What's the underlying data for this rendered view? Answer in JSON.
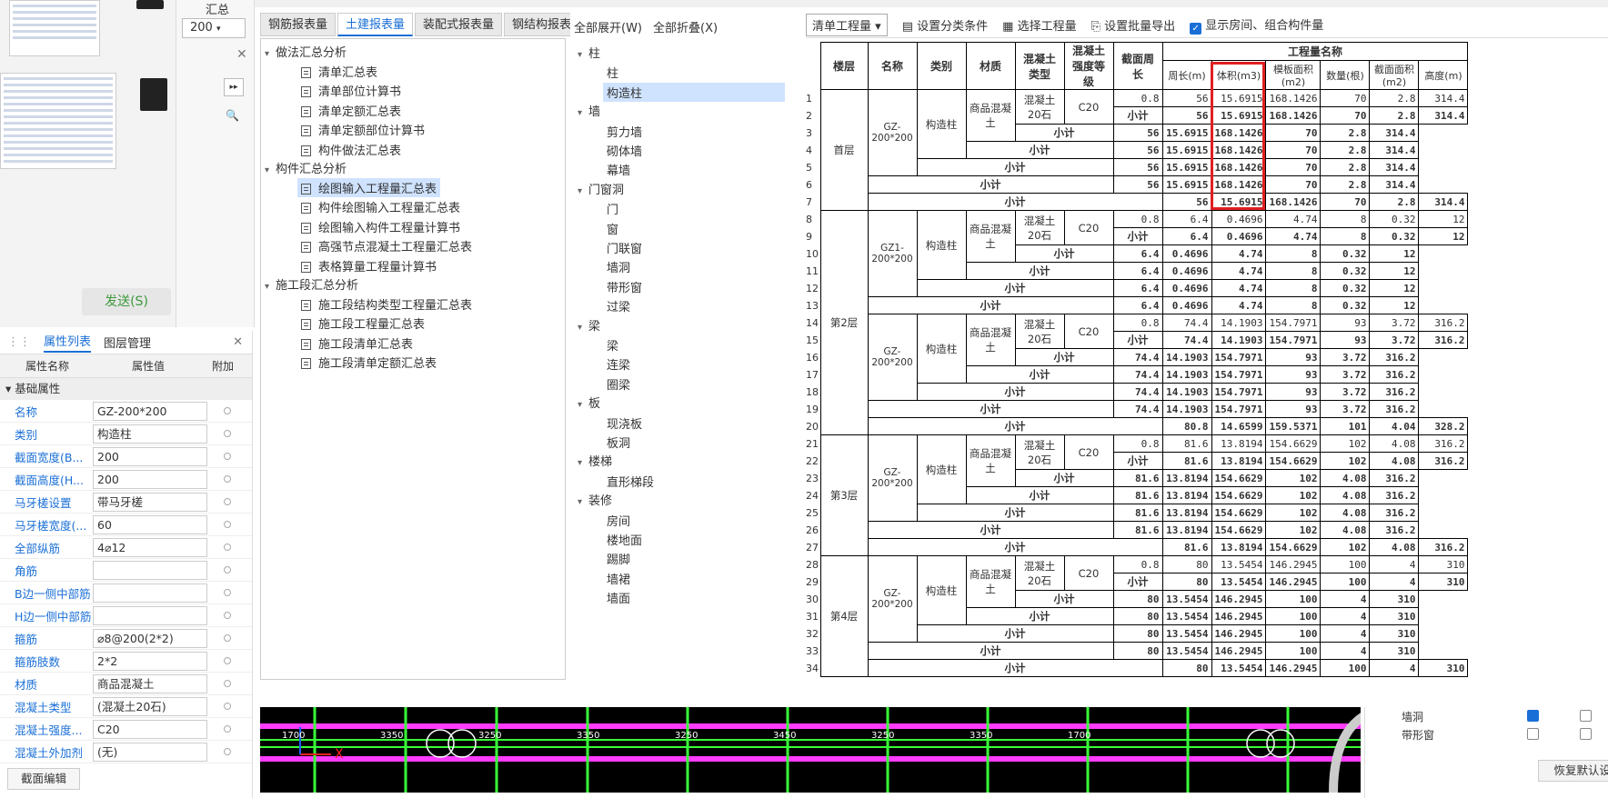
{
  "header": {
    "summary": "汇总",
    "spec": "200"
  },
  "chat": {
    "send_label": "发送(S)"
  },
  "report_tabs": [
    "钢筋报表量",
    "土建报表量",
    "装配式报表量",
    "钢结构报表量"
  ],
  "tree1": {
    "groups": [
      {
        "label": "做法汇总分析",
        "items": [
          "清单汇总表",
          "清单部位计算书",
          "清单定额汇总表",
          "清单定额部位计算书",
          "构件做法汇总表"
        ]
      },
      {
        "label": "构件汇总分析",
        "items": [
          "绘图输入工程量汇总表",
          "构件绘图输入工程量汇总表",
          "绘图输入构件工程量计算书",
          "高强节点混凝土工程量汇总表",
          "表格算量工程量计算书"
        ]
      },
      {
        "label": "施工段汇总分析",
        "items": [
          "施工段结构类型工程量汇总表",
          "施工段工程量汇总表",
          "施工段清单汇总表",
          "施工段清单定额汇总表"
        ]
      }
    ]
  },
  "tree2": {
    "expand_all": "全部展开(W)",
    "collapse_all": "全部折叠(X)",
    "groups": [
      {
        "label": "柱",
        "items": [
          "柱",
          "构造柱"
        ]
      },
      {
        "label": "墙",
        "items": [
          "剪力墙",
          "砌体墙",
          "幕墙"
        ]
      },
      {
        "label": "门窗洞",
        "items": [
          "门",
          "窗",
          "门联窗",
          "墙洞",
          "带形窗",
          "过梁"
        ]
      },
      {
        "label": "梁",
        "items": [
          "梁",
          "连梁",
          "圈梁"
        ]
      },
      {
        "label": "板",
        "items": [
          "现浇板",
          "板洞"
        ]
      },
      {
        "label": "楼梯",
        "items": [
          "直形梯段"
        ]
      },
      {
        "label": "装修",
        "items": [
          "房间",
          "楼地面",
          "踢脚",
          "墙裙",
          "墙面"
        ]
      }
    ]
  },
  "right_toolbar": {
    "combo": "清单工程量",
    "filter": "设置分类条件",
    "select": "选择工程量",
    "export": "设置批量导出",
    "show_rooms": "显示房间、组合构件量"
  },
  "props": {
    "tab_props": "属性列表",
    "tab_layers": "图层管理",
    "col_name": "属性名称",
    "col_value": "属性值",
    "col_extra": "附加",
    "section": "基础属性",
    "rows": [
      {
        "name": "名称",
        "value": "GZ-200*200"
      },
      {
        "name": "类别",
        "value": "构造柱"
      },
      {
        "name": "截面宽度(B...",
        "value": "200"
      },
      {
        "name": "截面高度(H...",
        "value": "200"
      },
      {
        "name": "马牙槎设置",
        "value": "带马牙槎"
      },
      {
        "name": "马牙槎宽度(...",
        "value": "60"
      },
      {
        "name": "全部纵筋",
        "value": "4⌀12"
      },
      {
        "name": "角筋",
        "value": ""
      },
      {
        "name": "B边一侧中部筋",
        "value": ""
      },
      {
        "name": "H边一侧中部筋",
        "value": ""
      },
      {
        "name": "箍筋",
        "value": "⌀8@200(2*2)"
      },
      {
        "name": "箍筋肢数",
        "value": "2*2"
      },
      {
        "name": "材质",
        "value": "商品混凝土"
      },
      {
        "name": "混凝土类型",
        "value": "(混凝土20石)"
      },
      {
        "name": "混凝土强度...",
        "value": "C20"
      },
      {
        "name": "混凝土外加剂",
        "value": "(无)"
      }
    ],
    "section_edit": "截面编辑"
  },
  "table": {
    "group_title": "工程量名称",
    "headers": [
      "楼层",
      "名称",
      "类别",
      "材质",
      "混凝土类型",
      "混凝土强度等级",
      "截面周长",
      "周长(m)",
      "体积(m3)",
      "模板面积(m2)",
      "数量(根)",
      "截面面积(m2)",
      "高度(m)"
    ],
    "sub_total": "小计",
    "floors": [
      {
        "floor": "首层",
        "name": "GZ-200*200",
        "cat": "构造柱",
        "mat": "商品混凝土",
        "ctype": "混凝土20石",
        "grade": "C20",
        "peri": "0.8",
        "vals": [
          [
            "56",
            "15.6915",
            "168.1426",
            "70",
            "2.8",
            "314.4"
          ],
          [
            "56",
            "15.6915",
            "168.1426",
            "70",
            "2.8",
            "314.4"
          ]
        ],
        "total": [
          "56",
          "15.6915",
          "168.1426",
          "70",
          "2.8",
          "314.4"
        ]
      },
      {
        "floor": "第2层",
        "blocks": [
          {
            "name": "GZ1-200*200",
            "cat": "构造柱",
            "mat": "商品混凝土",
            "ctype": "混凝土20石",
            "grade": "C20",
            "peri": "0.8",
            "vals": [
              "6.4",
              "0.4696",
              "4.74",
              "8",
              "0.32",
              "12"
            ]
          },
          {
            "name": "GZ-200*200",
            "cat": "构造柱",
            "mat": "商品混凝土",
            "ctype": "混凝土20石",
            "grade": "C20",
            "peri": "0.8",
            "vals": [
              "74.4",
              "14.1903",
              "154.7971",
              "93",
              "3.72",
              "316.2"
            ]
          }
        ],
        "total": [
          "80.8",
          "14.6599",
          "159.5371",
          "101",
          "4.04",
          "328.2"
        ]
      },
      {
        "floor": "第3层",
        "name": "GZ-200*200",
        "cat": "构造柱",
        "mat": "商品混凝土",
        "ctype": "混凝土20石",
        "grade": "C20",
        "peri": "0.8",
        "vals": [
          [
            "81.6",
            "13.8194",
            "154.6629",
            "102",
            "4.08",
            "316.2"
          ],
          [
            "81.6",
            "13.8194",
            "154.6629",
            "102",
            "4.08",
            "316.2"
          ]
        ],
        "total": [
          "81.6",
          "13.8194",
          "154.6629",
          "102",
          "4.08",
          "316.2"
        ]
      },
      {
        "floor": "第4层",
        "name": "GZ-200*200",
        "cat": "构造柱",
        "mat": "商品混凝土",
        "ctype": "混凝土20石",
        "grade": "C20",
        "peri": "0.8",
        "vals": [
          [
            "80",
            "13.5454",
            "146.2945",
            "100",
            "4",
            "310"
          ],
          [
            "80",
            "13.5454",
            "146.2945",
            "100",
            "4",
            "310"
          ]
        ],
        "total": [
          "80",
          "13.5454",
          "146.2945",
          "100",
          "4",
          "310"
        ]
      }
    ]
  },
  "cad_dims": [
    "1700",
    "3350",
    "3250",
    "3350",
    "3250",
    "3450",
    "3250",
    "3350",
    "1700"
  ],
  "bottom_right": {
    "rows": [
      "墙洞",
      "带形窗"
    ],
    "restore": "恢复默认设置"
  }
}
